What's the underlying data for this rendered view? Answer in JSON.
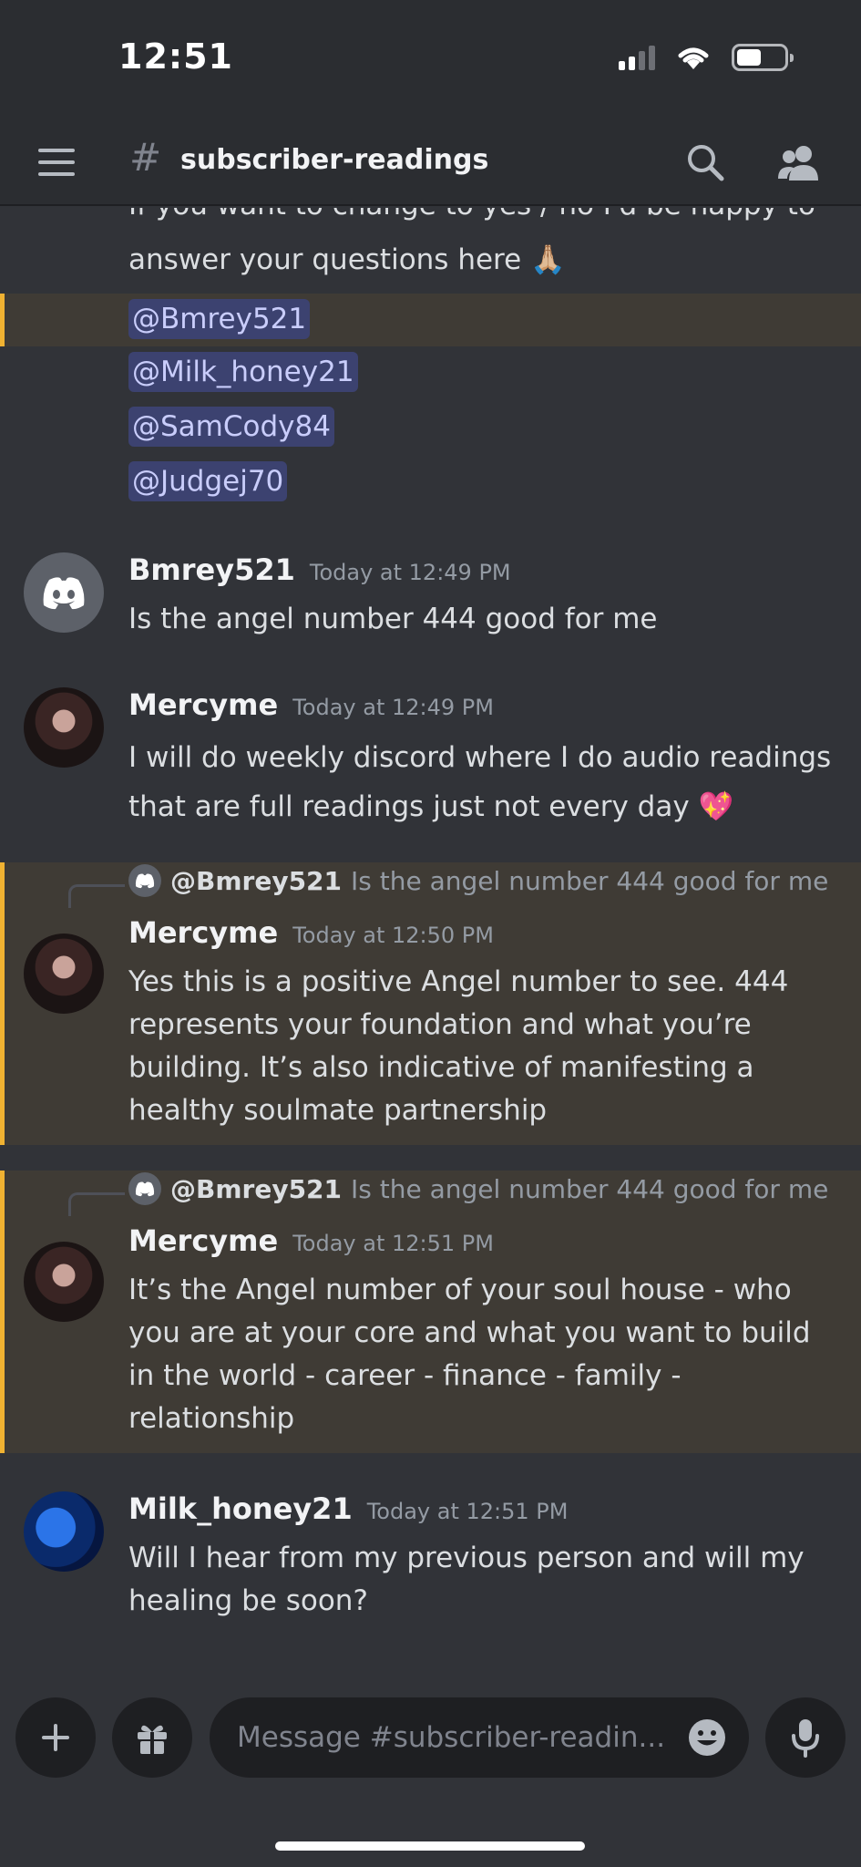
{
  "status_bar": {
    "time": "12:51"
  },
  "header": {
    "hash_symbol": "#",
    "channel": "subscriber-readings"
  },
  "top_partial": {
    "lines": [
      "If you want to change to yes / no I'd be happy to",
      "answer your questions here 🙏🏼"
    ],
    "mentions": [
      "@Bmrey521",
      "@Milk_honey21",
      "@SamCody84",
      "@Judgej70"
    ]
  },
  "messages": [
    {
      "user": "Bmrey521",
      "time": "Today at 12:49 PM",
      "text": "Is the angel number 444 good for me"
    },
    {
      "user": "Mercyme",
      "time": "Today at 12:49 PM",
      "text": "I will do weekly discord where I do audio readings that are full readings just not every day 💖"
    },
    {
      "reply_user": "@Bmrey521",
      "reply_text": "Is the angel number 444 good for me",
      "user": "Mercyme",
      "time": "Today at 12:50 PM",
      "text": "Yes this is a positive Angel number to see. 444 represents your foundation and what you’re building. It’s also indicative of manifesting a healthy soulmate partnership"
    },
    {
      "reply_user": "@Bmrey521",
      "reply_text": "Is the angel number 444 good for me",
      "user": "Mercyme",
      "time": "Today at 12:51 PM",
      "text": "It’s the Angel number of your soul house - who you are at your core and what you want to build in the world - career - finance - family - relationship"
    },
    {
      "user": "Milk_honey21",
      "time": "Today at 12:51 PM",
      "text": "Will I hear from my previous person and will my healing be soon?"
    }
  ],
  "composer": {
    "placeholder": "Message #subscriber-readin..."
  },
  "colors": {
    "accent_highlight": "#f0b232",
    "mention_bg": "#3c4270",
    "background": "#313338"
  },
  "icons": [
    "hamburger-icon",
    "search-icon",
    "members-icon",
    "plus-icon",
    "gift-icon",
    "emoji-icon",
    "microphone-icon",
    "discord-logo-icon"
  ]
}
